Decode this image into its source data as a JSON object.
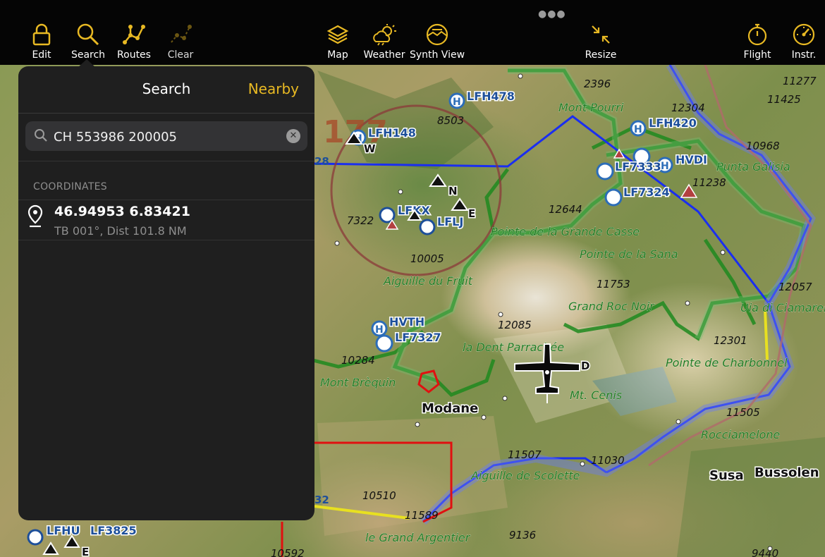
{
  "toolbar": {
    "left": [
      {
        "label": "Edit",
        "icon": "lock-icon"
      },
      {
        "label": "Search",
        "icon": "search-icon"
      },
      {
        "label": "Routes",
        "icon": "routes-icon"
      },
      {
        "label": "Clear",
        "icon": "clear-icon"
      }
    ],
    "center": [
      {
        "label": "Map",
        "icon": "layers-icon"
      },
      {
        "label": "Weather",
        "icon": "weather-icon"
      },
      {
        "label": "Synth View",
        "icon": "synth-view-icon"
      },
      {
        "label": "Resize",
        "icon": "resize-icon"
      }
    ],
    "right": [
      {
        "label": "Flight",
        "icon": "stopwatch-icon"
      },
      {
        "label": "Instr.",
        "icon": "gauge-icon"
      }
    ],
    "accent": "#e8b923"
  },
  "search_panel": {
    "title": "Search",
    "nearby_label": "Nearby",
    "query": "CH 553986 200005",
    "section_header": "COORDINATES",
    "result": {
      "title": "46.94953 6.83421",
      "subtitle": "TB 001°, Dist 101.8 NM"
    }
  },
  "map": {
    "places": [
      "Modane",
      "Susa",
      "Bussolen"
    ],
    "terrain_labels": [
      "Mont Pourri",
      "Pointe de la Grande Casse",
      "Pointe de la Sana",
      "Aiguille du Fruit",
      "Grand Roc Noir",
      "la Dent Parrachée",
      "Pointe de Charbonnel",
      "Uia di Ciamarel",
      "Mont Brèquin",
      "Mt. Cenis",
      "Rocciamelone",
      "Aiguille de Scolette",
      "le Grand Argentier",
      "Punta Galisia"
    ],
    "elevations": [
      "8503",
      "2396",
      "12304",
      "11277",
      "11425",
      "10968",
      "11238",
      "12644",
      "7322",
      "10005",
      "11753",
      "12057",
      "12085",
      "12301",
      "10284",
      "11505",
      "11507",
      "11030",
      "10510",
      "9136",
      "9440",
      "10592",
      "11589"
    ],
    "heliports": [
      "LFH478",
      "LFH148",
      "LFH420",
      "LF7333",
      "HVDI",
      "LF7324",
      "HVTH",
      "LF7327",
      "LF3825"
    ],
    "airports": [
      "LFKX",
      "LFLJ",
      "LFHU"
    ],
    "waypoints": [
      "N",
      "E",
      "W",
      "D",
      "E"
    ],
    "airspace_labels": [
      "177",
      "28",
      "32"
    ],
    "colors": {
      "airspace_blue": "#1a2ef0",
      "park_green": "#1f8a1f",
      "danger_red": "#e01010",
      "airport_blue": "#1d4f9a",
      "heli_blue": "#2c6db8"
    }
  }
}
